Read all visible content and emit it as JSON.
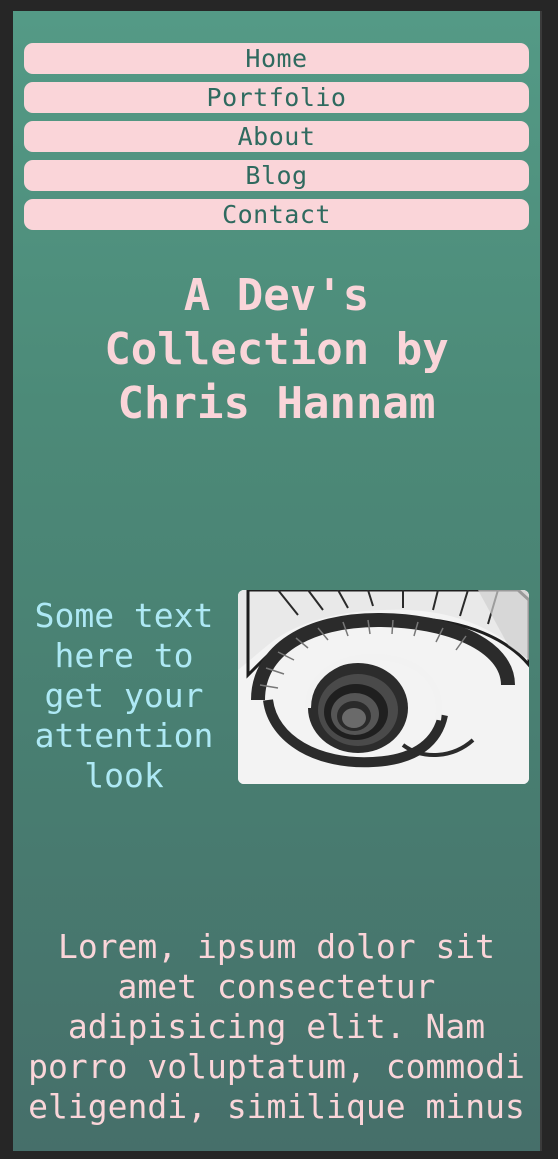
{
  "nav": {
    "items": [
      {
        "label": "Home"
      },
      {
        "label": "Portfolio"
      },
      {
        "label": "About"
      },
      {
        "label": "Blog"
      },
      {
        "label": "Contact"
      }
    ]
  },
  "hero": {
    "title": "A Dev's Collection by Chris Hannam"
  },
  "feature": {
    "text": "Some text here to get your attention look",
    "image_icon": "spiral-staircase-photo"
  },
  "body": {
    "text": "Lorem, ipsum dolor sit amet consectetur adipisicing elit. Nam porro voluptatum, commodi eligendi, similique minus"
  },
  "colors": {
    "background_top": "#549a86",
    "background_bottom": "#466f6a",
    "nav_button": "#fad5d9",
    "nav_text": "#2f6a5f",
    "title_text": "#fad5d9",
    "callout_text": "#aee9f5",
    "body_text": "#fad5d9"
  }
}
